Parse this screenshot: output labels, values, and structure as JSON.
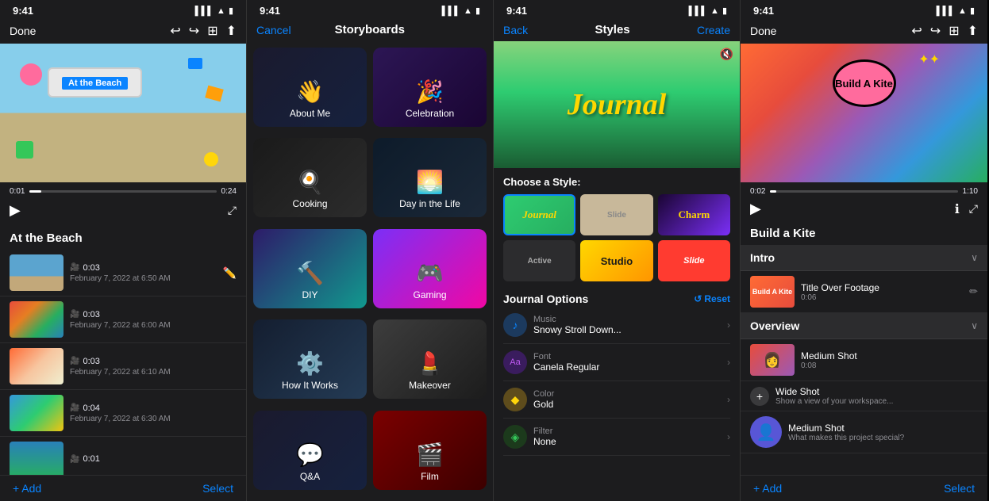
{
  "phone1": {
    "statusTime": "9:41",
    "navLeft": "Done",
    "navTitle": "",
    "videoTime": {
      "current": "0:01",
      "total": "0:24"
    },
    "sceneTitle": "At the Beach",
    "scenes": [
      {
        "duration": "0:03",
        "date": "February 7, 2022 at 6:50 AM",
        "thumbType": "beach"
      },
      {
        "duration": "0:03",
        "date": "February 7, 2022 at 6:00 AM",
        "thumbType": "people"
      },
      {
        "duration": "0:03",
        "date": "February 7, 2022 at 6:10 AM",
        "thumbType": "kite"
      },
      {
        "duration": "0:04",
        "date": "February 7, 2022 at 6:30 AM",
        "thumbType": "beach2"
      },
      {
        "duration": "0:01",
        "date": "",
        "thumbType": "people2"
      }
    ],
    "addLabel": "+ Add",
    "selectLabel": "Select",
    "beachMonitorText": "At the Beach"
  },
  "phone2": {
    "statusTime": "9:41",
    "navCancel": "Cancel",
    "navTitle": "Storyboards",
    "storyboards": [
      {
        "label": "About Me",
        "icon": "👋",
        "bg": "aboutme"
      },
      {
        "label": "Celebration",
        "icon": "🎉",
        "bg": "celebration"
      },
      {
        "label": "Cooking",
        "icon": "🍳",
        "bg": "cooking"
      },
      {
        "label": "Day in the Life",
        "icon": "🌅",
        "bg": "dayinlife"
      },
      {
        "label": "DIY",
        "icon": "🔨",
        "bg": "diy"
      },
      {
        "label": "Gaming",
        "icon": "🎮",
        "bg": "gaming"
      },
      {
        "label": "How It Works",
        "icon": "⚙️",
        "bg": "howitworks"
      },
      {
        "label": "Makeover",
        "icon": "💄",
        "bg": "makeover"
      },
      {
        "label": "Q&A",
        "icon": "💬",
        "bg": "qa"
      },
      {
        "label": "Film",
        "icon": "🎬",
        "bg": "film"
      }
    ]
  },
  "phone3": {
    "statusTime": "9:41",
    "navBack": "Back",
    "navTitle": "Styles",
    "navCreate": "Create",
    "previewTitle": "Journal",
    "chooseStyleLabel": "Choose a Style:",
    "styles": [
      {
        "label": "Journal",
        "type": "journal"
      },
      {
        "label": "Slide",
        "type": "slide"
      },
      {
        "label": "Charm",
        "type": "charm"
      },
      {
        "label": "Active",
        "type": "active"
      },
      {
        "label": "Studio",
        "type": "studio"
      },
      {
        "label": "Slide",
        "type": "slide2"
      }
    ],
    "optionsTitle": "Journal Options",
    "resetLabel": "Reset",
    "options": [
      {
        "icon": "♪",
        "label": "Music",
        "value": "Snowy Stroll Down...",
        "bg": "#1c3a5e"
      },
      {
        "icon": "Aa",
        "label": "Font",
        "value": "Canela Regular",
        "bg": "#3a1c5e"
      },
      {
        "icon": "◆",
        "label": "Color",
        "value": "Gold",
        "bg": "#5e4c1c"
      },
      {
        "icon": "◈",
        "label": "Filter",
        "value": "None",
        "bg": "#1c3a1c"
      }
    ]
  },
  "phone4": {
    "statusTime": "9:41",
    "navLeft": "Done",
    "videoTime": {
      "current": "0:02",
      "total": "1:10"
    },
    "sceneTitle": "Build a Kite",
    "kiteTitle": "Build A Kite",
    "sections": [
      {
        "title": "Intro",
        "items": [
          {
            "label": "Title Over Footage",
            "sub": "0:06",
            "thumbType": "kite-small"
          }
        ]
      },
      {
        "title": "Overview",
        "items": [
          {
            "label": "Medium Shot",
            "sub": "0:08",
            "thumbType": "person-medium"
          },
          {
            "label": "Wide Shot",
            "sub": "Show a view of your workspace...",
            "thumbType": "workspace"
          },
          {
            "label": "Medium Shot",
            "sub": "What makes this project special?",
            "thumbType": "person-icon"
          }
        ]
      }
    ],
    "addLabel": "+ Add",
    "selectLabel": "Select"
  }
}
